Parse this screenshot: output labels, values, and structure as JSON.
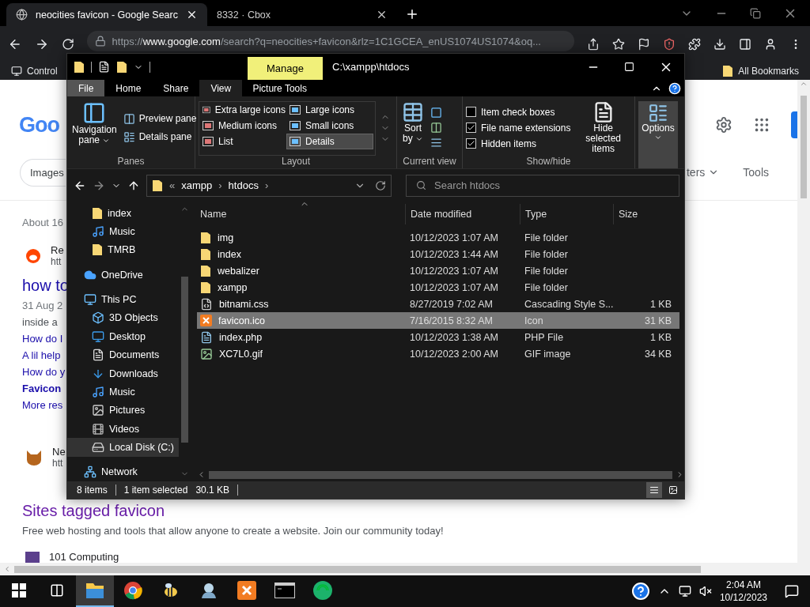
{
  "browser": {
    "tabs": [
      {
        "title": "neocities favicon - Google Searc",
        "selected": true
      },
      {
        "title": "8332 · Cbox",
        "selected": false
      }
    ],
    "url": {
      "scheme": "https://",
      "host": "www.google.com",
      "path": "/search?q=neocities+favicon&rlz=1C1GCEA_enUS1074US1074&oq..."
    },
    "bookmark": "Control",
    "all_bookmarks": "All Bookmarks"
  },
  "google": {
    "logo": "Goo",
    "chip": "Images",
    "filters": "ters",
    "tools": "Tools",
    "results": [
      {
        "kind": "count",
        "text": "About 16"
      },
      {
        "kind": "source",
        "name": "Re",
        "url": "htt"
      },
      {
        "kind": "title",
        "text": "how to"
      },
      {
        "kind": "meta",
        "text": "31 Aug 2"
      },
      {
        "kind": "snippet",
        "text": "inside a"
      },
      {
        "kind": "link",
        "text": "How do I"
      },
      {
        "kind": "link",
        "text": "A lil help"
      },
      {
        "kind": "link",
        "text": "How do y"
      },
      {
        "kind": "strong",
        "text": "Favicon"
      },
      {
        "kind": "link",
        "text": "More res"
      },
      {
        "kind": "source",
        "name": "Ne",
        "url": "htt"
      },
      {
        "kind": "visited",
        "text": "Sites tagged favicon"
      },
      {
        "kind": "snippet",
        "text": "Free web hosting and tools that allow anyone to create a website. Join our community today!"
      },
      {
        "kind": "source",
        "name": "101 Computing"
      }
    ]
  },
  "explorer": {
    "title": "C:\\xampp\\htdocs",
    "context_tab": "Manage",
    "ribbon_tabs": [
      {
        "label": "File",
        "kind": "file",
        "selected": false
      },
      {
        "label": "Home",
        "kind": "tab",
        "selected": false
      },
      {
        "label": "Share",
        "kind": "tab",
        "selected": false
      },
      {
        "label": "View",
        "kind": "tab",
        "selected": true
      },
      {
        "label": "Picture Tools",
        "kind": "context",
        "selected": false
      }
    ],
    "panes": {
      "label": "Panes",
      "navigation": "Navigation",
      "navigation_2": "pane",
      "preview": "Preview pane",
      "details": "Details pane"
    },
    "layout": {
      "label": "Layout",
      "options": [
        {
          "label": "Extra large icons",
          "selected": false
        },
        {
          "label": "Large icons",
          "selected": false
        },
        {
          "label": "Medium icons",
          "selected": false
        },
        {
          "label": "Small icons",
          "selected": false
        },
        {
          "label": "List",
          "selected": false
        },
        {
          "label": "Details",
          "selected": true
        }
      ]
    },
    "current_view": {
      "label": "Current view",
      "sort": "Sort",
      "sort_2": "by"
    },
    "show_hide": {
      "label": "Show/hide",
      "checkboxes": [
        {
          "label": "Item check boxes",
          "checked": false
        },
        {
          "label": "File name extensions",
          "checked": true
        },
        {
          "label": "Hidden items",
          "checked": true
        }
      ],
      "hide_selected": "Hide selected items"
    },
    "options": "Options",
    "path": [
      "«",
      "xampp",
      "›",
      "htdocs",
      "›"
    ],
    "search_placeholder": "Search htdocs",
    "quick_access": [
      {
        "label": "index",
        "kind": "folder",
        "selected": false
      },
      {
        "label": "Music",
        "kind": "music",
        "selected": false
      },
      {
        "label": "TMRB",
        "kind": "folder",
        "selected": false
      }
    ],
    "nav": [
      {
        "label": "OneDrive",
        "kind": "cloud",
        "selected": false
      },
      {
        "label": "This PC",
        "kind": "pc",
        "selected": false,
        "children": [
          {
            "label": "3D Objects",
            "kind": "cube",
            "selected": false
          },
          {
            "label": "Desktop",
            "kind": "desktop",
            "selected": false
          },
          {
            "label": "Documents",
            "kind": "document",
            "selected": false
          },
          {
            "label": "Downloads",
            "kind": "download",
            "selected": false
          },
          {
            "label": "Music",
            "kind": "music",
            "selected": false
          },
          {
            "label": "Pictures",
            "kind": "picture",
            "selected": false
          },
          {
            "label": "Videos",
            "kind": "video",
            "selected": false
          },
          {
            "label": "Local Disk (C:)",
            "kind": "disk",
            "selected": true
          }
        ]
      },
      {
        "label": "Network",
        "kind": "network",
        "selected": false
      }
    ],
    "columns": [
      "Name",
      "Date modified",
      "Type",
      "Size"
    ],
    "files": [
      {
        "name": "img",
        "kind": "folder",
        "date": "10/12/2023 1:07 AM",
        "type": "File folder",
        "selected": false
      },
      {
        "name": "index",
        "kind": "folder",
        "date": "10/12/2023 1:44 AM",
        "type": "File folder",
        "selected": false
      },
      {
        "name": "webalizer",
        "kind": "folder",
        "date": "10/12/2023 1:07 AM",
        "type": "File folder",
        "selected": false
      },
      {
        "name": "xampp",
        "kind": "folder",
        "date": "10/12/2023 1:07 AM",
        "type": "File folder",
        "selected": false
      },
      {
        "name": "bitnami.css",
        "kind": "css",
        "date": "8/27/2019 7:02 AM",
        "type": "Cascading Style S...",
        "size": "1 KB",
        "selected": false
      },
      {
        "name": "favicon.ico",
        "kind": "ico",
        "date": "7/16/2015 8:32 AM",
        "type": "Icon",
        "size": "31 KB",
        "selected": true
      },
      {
        "name": "index.php",
        "kind": "php",
        "date": "10/12/2023 1:38 AM",
        "type": "PHP File",
        "size": "1 KB",
        "selected": false
      },
      {
        "name": "XC7L0.gif",
        "kind": "gif",
        "date": "10/12/2023 2:00 AM",
        "type": "GIF image",
        "size": "34 KB",
        "selected": false
      }
    ],
    "status": [
      "8 items",
      "1 item selected",
      "30.1 KB"
    ],
    "views": [
      {
        "kind": "details",
        "selected": true
      },
      {
        "kind": "tiles",
        "selected": false
      }
    ]
  },
  "taskbar": {
    "apps": [
      {
        "kind": "explorer",
        "active": true
      },
      {
        "kind": "browser",
        "active": false
      },
      {
        "kind": "bee",
        "active": false
      },
      {
        "kind": "figure",
        "active": false
      },
      {
        "kind": "xampp",
        "active": false
      },
      {
        "kind": "terminal",
        "active": false
      },
      {
        "kind": "ring",
        "active": false
      }
    ],
    "time": "2:04 AM",
    "date": "10/12/2023"
  }
}
